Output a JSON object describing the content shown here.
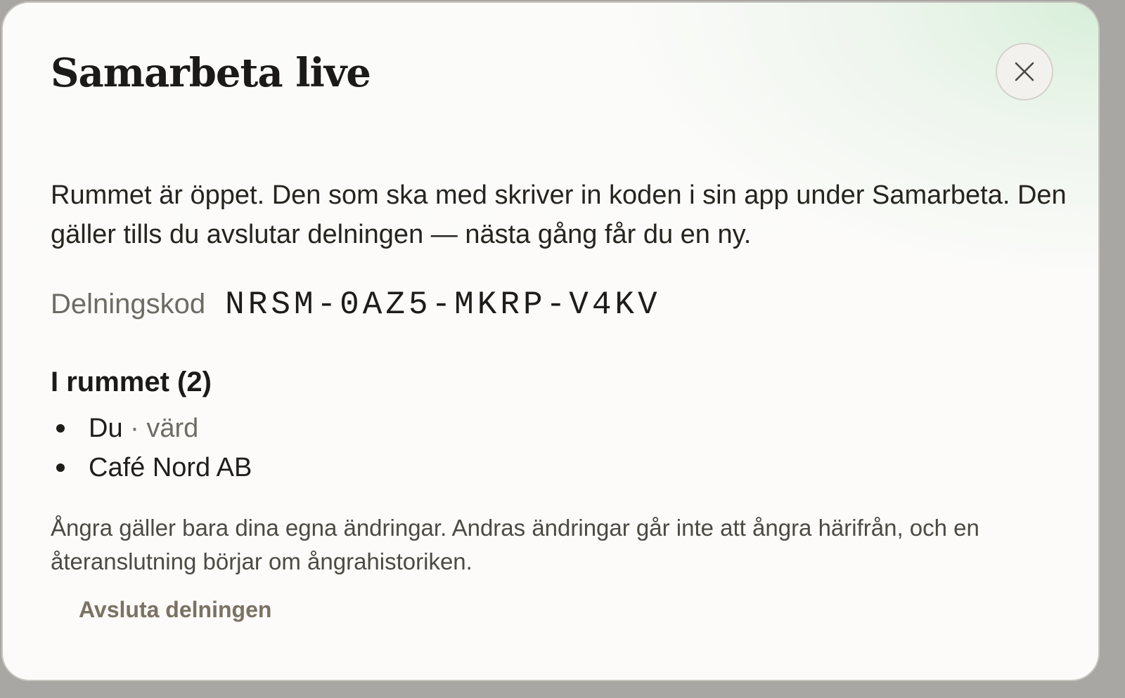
{
  "dialog": {
    "title": "Samarbeta live",
    "close_icon": "close-icon",
    "description": "Rummet är öppet. Den som ska med skriver in koden i sin app under Samarbeta. Den gäller tills du avslutar delningen — nästa gång får du en ny.",
    "share_code": {
      "label": "Delningskod",
      "value": "NRSM-0AZ5-MKRP-V4KV"
    },
    "room": {
      "heading": "I rummet (2)",
      "members": [
        {
          "name": "Du",
          "role": "· värd"
        },
        {
          "name": "Café Nord AB",
          "role": ""
        }
      ]
    },
    "undo_note": "Ångra gäller bara dina egna ändringar. Andras ändringar går inte att ångra härifrån, och en återanslutning börjar om ångrahistoriken.",
    "end_share_label": "Avsluta delningen"
  }
}
